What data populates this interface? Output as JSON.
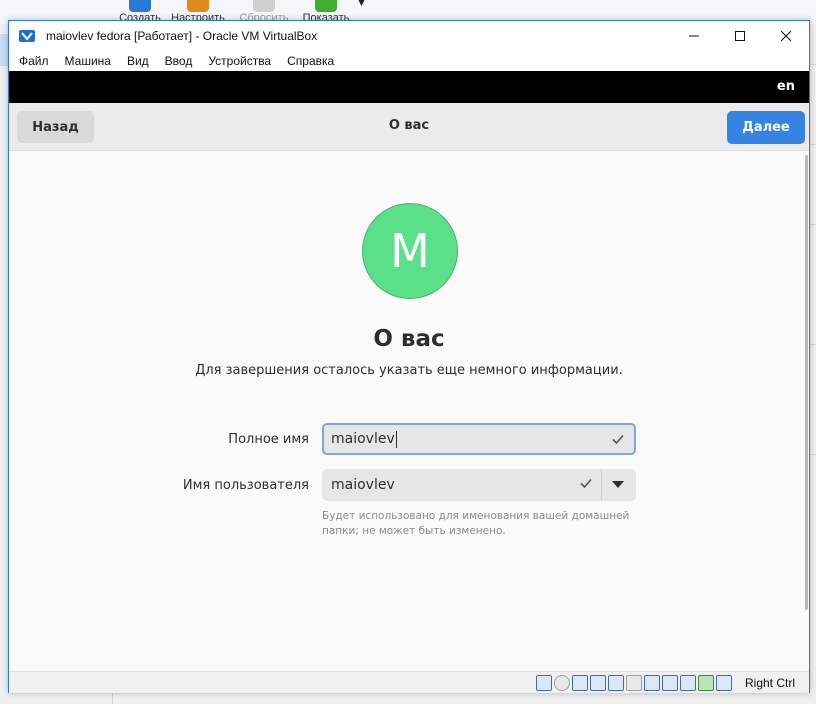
{
  "background_toolbar": {
    "tools": [
      {
        "label": "Создать",
        "icon": "new-vm-icon",
        "color": "#2a78d6"
      },
      {
        "label": "Настроить",
        "icon": "settings-icon",
        "color": "#e08a1e"
      },
      {
        "label": "Сбросить",
        "icon": "discard-icon",
        "color": "#bdbdbd"
      },
      {
        "label": "Показать",
        "icon": "show-icon",
        "color": "#3fae2a"
      }
    ]
  },
  "window": {
    "title": "maiovlev fedora [Работает] - Oracle VM VirtualBox",
    "menu": [
      "Файл",
      "Машина",
      "Вид",
      "Ввод",
      "Устройства",
      "Справка"
    ]
  },
  "guest": {
    "language": "en",
    "header": {
      "back_label": "Назад",
      "title": "О вас",
      "next_label": "Далее"
    },
    "avatar_letter": "M",
    "heading": "О вас",
    "subtitle": "Для завершения осталось указать еще немного информации.",
    "full_name": {
      "label": "Полное имя",
      "value": "maiovlev"
    },
    "username": {
      "label": "Имя пользователя",
      "value": "maiovlev"
    },
    "hint": "Будет использовано для именования вашей домашней папки; не может быть изменено.",
    "colors": {
      "accent": "#3584e4",
      "avatar": "#5be08a"
    }
  },
  "statusbar": {
    "host_key": "Right Ctrl"
  }
}
